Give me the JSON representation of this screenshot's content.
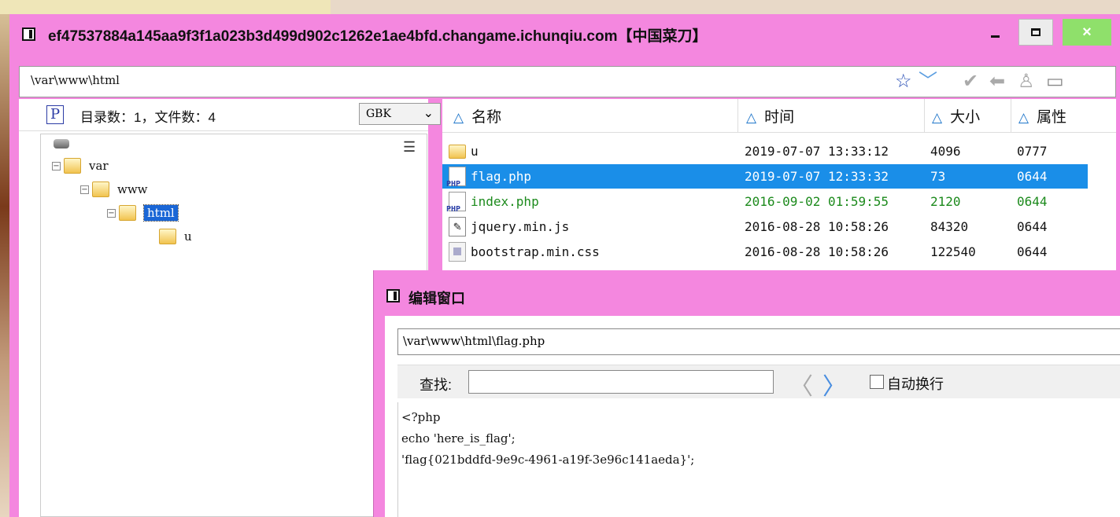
{
  "window": {
    "title": "ef47537884a145aa9f3f1a023b3d499d902c1262e1ae4bfd.changame.ichunqiu.com【中国菜刀】",
    "close_glyph": "×"
  },
  "address": {
    "path": "\\var\\www\\html",
    "icons": [
      "star-icon",
      "chevron-down-icon",
      "check-icon",
      "back-arrow-icon",
      "user-icon",
      "window-icon"
    ]
  },
  "left": {
    "counts": "目录数：1，文件数：4",
    "encoding": "GBK",
    "tree": [
      {
        "label": "var"
      },
      {
        "label": "www"
      },
      {
        "label": "html"
      },
      {
        "label": "u"
      }
    ]
  },
  "files": {
    "columns": [
      "名称",
      "时间",
      "大小",
      "属性"
    ],
    "rows": [
      {
        "name": "u",
        "time": "2019-07-07 13:33:12",
        "size": "4096",
        "attr": "0777",
        "type": "folder"
      },
      {
        "name": "flag.php",
        "time": "2019-07-07 12:33:32",
        "size": "73",
        "attr": "0644",
        "type": "php"
      },
      {
        "name": "index.php",
        "time": "2016-09-02 01:59:55",
        "size": "2120",
        "attr": "0644",
        "type": "php"
      },
      {
        "name": "jquery.min.js",
        "time": "2016-08-28 10:58:26",
        "size": "84320",
        "attr": "0644",
        "type": "js"
      },
      {
        "name": "bootstrap.min.css",
        "time": "2016-08-28 10:58:26",
        "size": "122540",
        "attr": "0644",
        "type": "css"
      }
    ]
  },
  "editor": {
    "title": "编辑窗口",
    "path": "\\var\\www\\html\\flag.php",
    "find_label": "查找:",
    "find_value": "",
    "wrap_label": "自动换行",
    "code": [
      "<?php",
      "echo 'here_is_flag';",
      "'flag{021bddfd-9e9c-4961-a19f-3e96c141aeda}';"
    ]
  }
}
